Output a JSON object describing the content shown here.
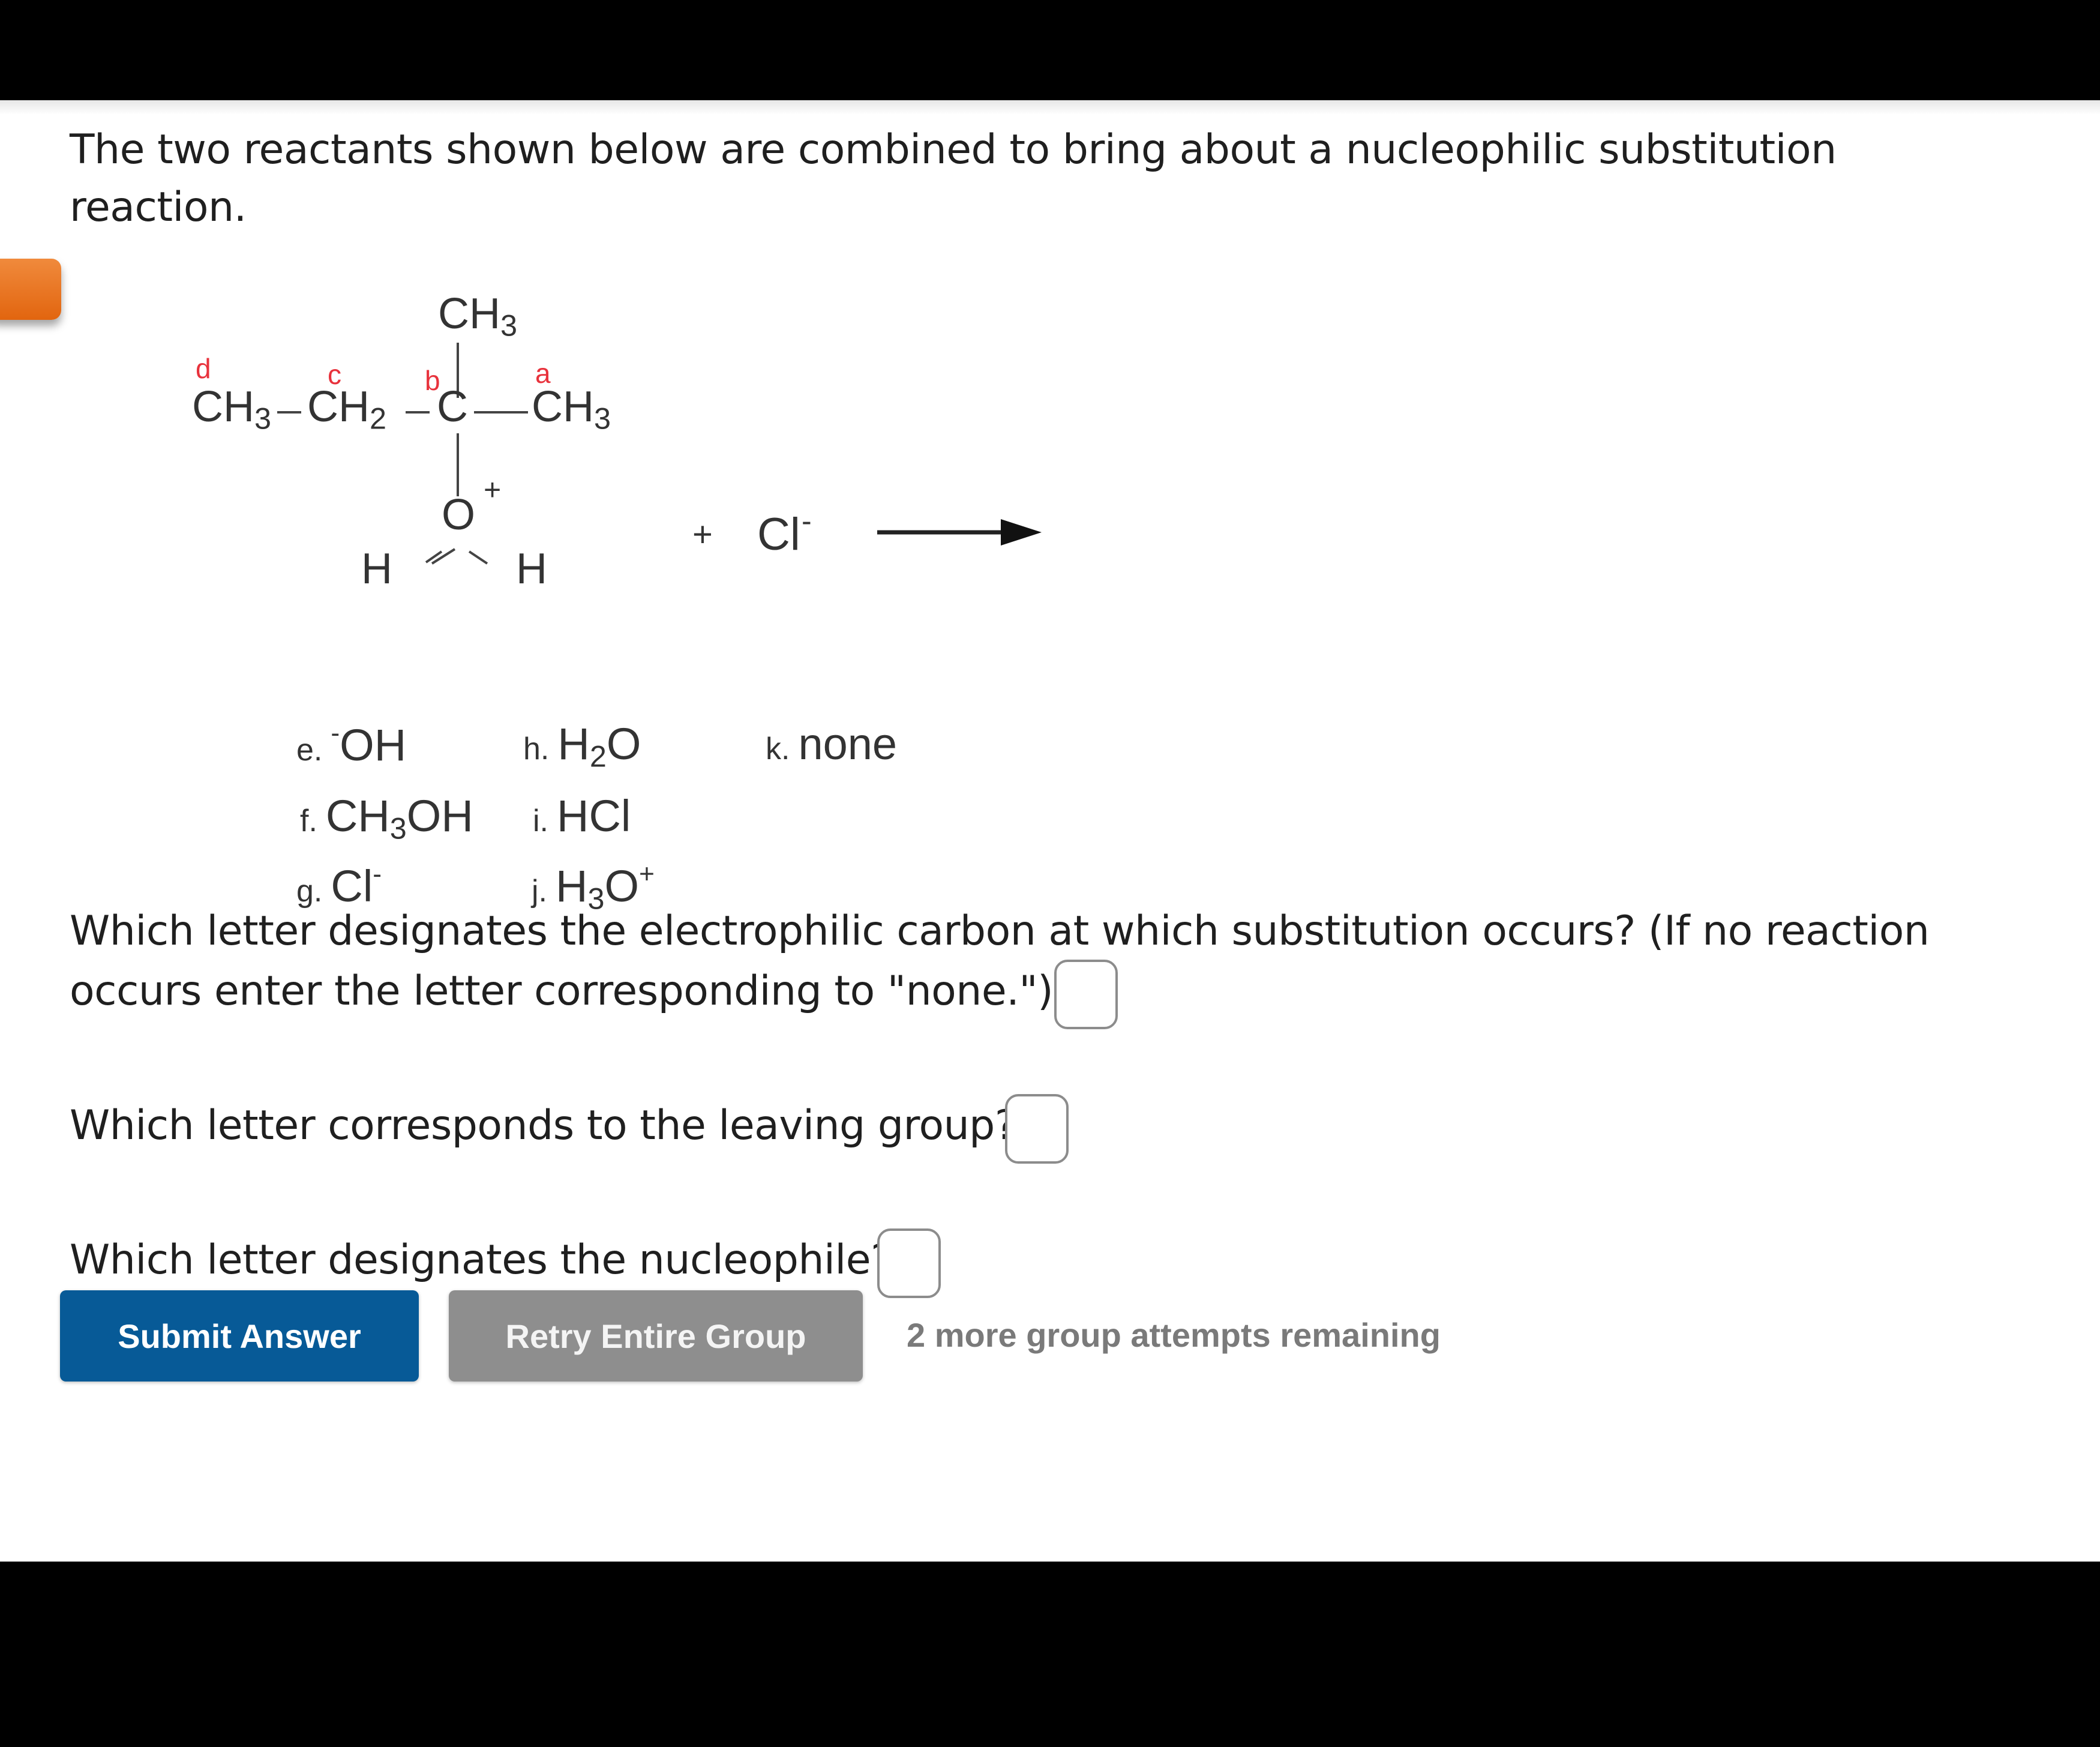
{
  "intro": {
    "line1": "The two reactants shown below are combined to bring about a nucleophilic substitution",
    "line2": "reaction."
  },
  "reaction": {
    "top_methyl": "CH3",
    "chain": [
      "CH3",
      "CH2",
      "C",
      "CH3"
    ],
    "labels": {
      "d": "d",
      "c": "c",
      "b": "b",
      "a": "a"
    },
    "oxygen": "O",
    "oxygen_charge": "+",
    "hydrogens": [
      "H",
      "H"
    ],
    "plus": "+",
    "reagent": "Cl",
    "reagent_charge": "-",
    "arrow": "right-arrow"
  },
  "options": [
    {
      "letter": "e.",
      "formula": "OH",
      "prefix_charge": "-"
    },
    {
      "letter": "f.",
      "formula": "CH3OH"
    },
    {
      "letter": "g.",
      "formula": "Cl",
      "charge": "-"
    },
    {
      "letter": "h.",
      "formula": "H2O"
    },
    {
      "letter": "i.",
      "formula": "HCl"
    },
    {
      "letter": "j.",
      "formula": "H3O",
      "charge": "+"
    },
    {
      "letter": "k.",
      "formula": "none"
    }
  ],
  "questions": {
    "q1_line1": "Which letter designates the electrophilic carbon at which substitution occurs? (If no reaction",
    "q1_line2": "occurs enter the letter corresponding to \"none.\")",
    "q1_value": "",
    "q2": "Which letter corresponds to the leaving group?",
    "q2_value": "",
    "q3": "Which letter designates the nucleophile?",
    "q3_value": ""
  },
  "actions": {
    "submit_label": "Submit Answer",
    "retry_label": "Retry Entire Group",
    "attempts_text": "2 more group attempts remaining"
  },
  "colors": {
    "submit": "#075a97",
    "retry": "#8e8e8e",
    "label_red": "#e8323c",
    "tab_orange": "#e86f1c"
  }
}
